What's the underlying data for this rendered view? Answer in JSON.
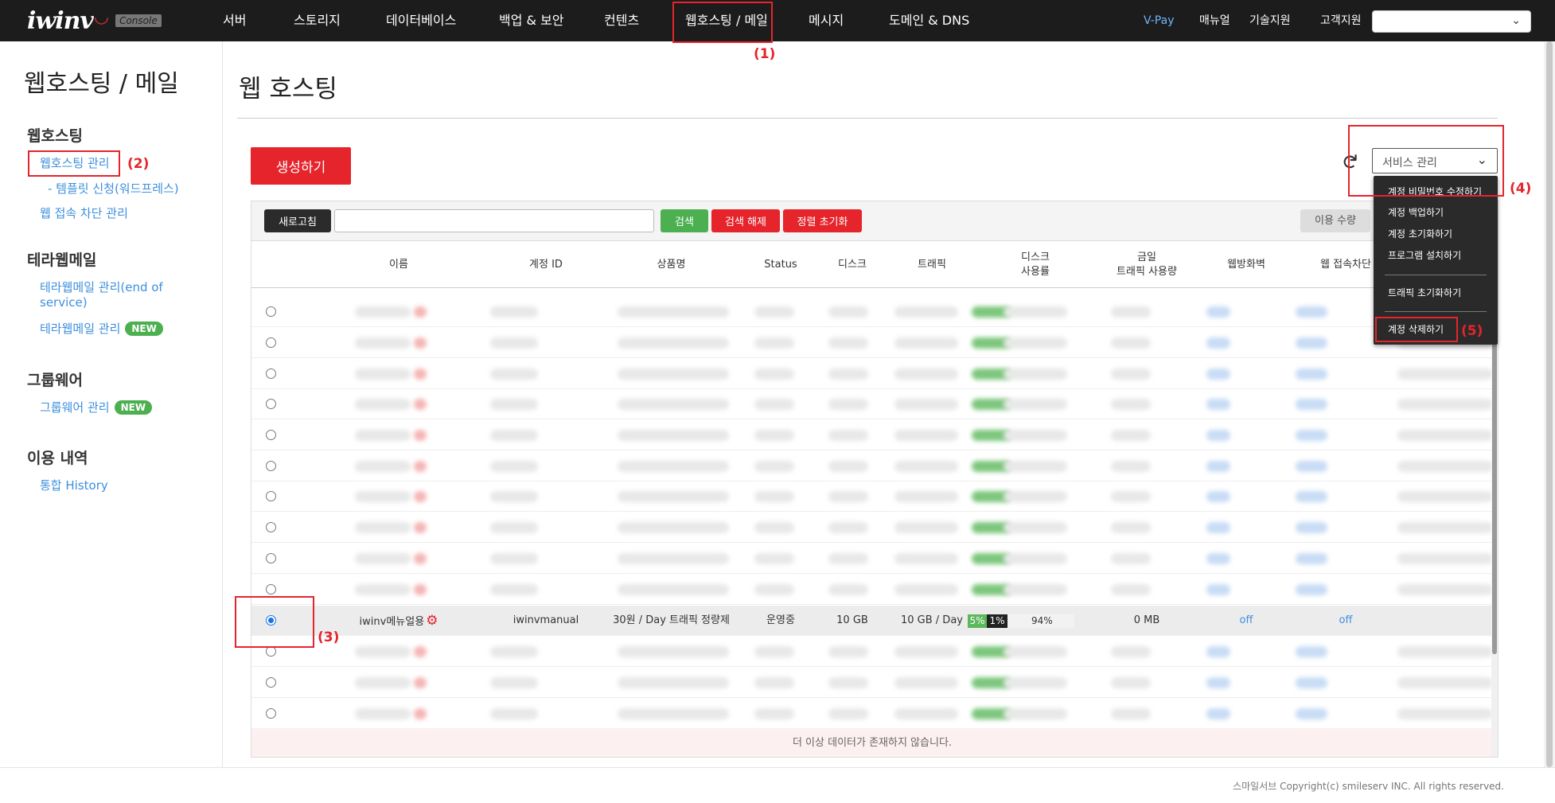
{
  "brand": {
    "logo": "iwinv",
    "console": "Console"
  },
  "nav": {
    "items": [
      "서버",
      "스토리지",
      "데이터베이스",
      "백업 & 보안",
      "컨텐츠",
      "웹호스팅 / 메일",
      "메시지",
      "도메인 & DNS"
    ],
    "right": [
      "V-Pay",
      "매뉴얼",
      "기술지원",
      "고객지원"
    ],
    "account_select": ""
  },
  "sidebar": {
    "title": "웹호스팅 / 메일",
    "sections": [
      {
        "heading": "웹호스팅",
        "links": [
          "웹호스팅 관리",
          "- 템플릿 신청(워드프레스)",
          "웹 접속 차단 관리"
        ]
      },
      {
        "heading": "테라웹메일",
        "links": [
          "테라웹메일 관리(end of",
          "service)",
          "테라웹메일 관리"
        ]
      },
      {
        "heading": "그룹웨어",
        "links": [
          "그룹웨어 관리"
        ]
      },
      {
        "heading": "이용 내역",
        "links": [
          "통합 History"
        ]
      }
    ],
    "new_badge": "NEW"
  },
  "main": {
    "title": "웹 호스팅",
    "create_button": "생성하기",
    "service_select": "서비스 관리"
  },
  "toolbar": {
    "refresh": "새로고침",
    "search_value": "",
    "search": "검색",
    "clear_search": "검색 해제",
    "reset_sort": "정렬 초기화",
    "usage": "이용 수량"
  },
  "table": {
    "headers": [
      "이름",
      "계정 ID",
      "상품명",
      "Status",
      "디스크",
      "트래픽",
      "디스크\n사용률",
      "금일\n트래픽 사용량",
      "웹방화벽",
      "웹 접속차단"
    ],
    "selected_row": {
      "name": "iwinv메뉴얼용",
      "account_id": "iwinvmanual",
      "product": "30원 / Day 트래픽 정량제",
      "status": "운영중",
      "disk": "10 GB",
      "traffic": "10 GB / Day",
      "disk_usage_pct": "5%",
      "disk_usage_2": "1%",
      "traffic_pct": "94%",
      "today_traffic": "0 MB",
      "waf": "off",
      "web_block": "off"
    },
    "footer_message": "더 이상 데이터가 존재하지 않습니다."
  },
  "menu": {
    "items": [
      "계정 비밀번호 수정하기",
      "계정 백업하기",
      "계정 초기화하기",
      "프로그램 설치하기",
      "트래픽 초기화하기",
      "계정 삭제하기"
    ],
    "partial_text": "계정 삭제하기"
  },
  "annotations": [
    "(1)",
    "(2)",
    "(3)",
    "(4)",
    "(5)"
  ],
  "footer": {
    "copyright": "스마일서브 Copyright(c) smileserv INC. All rights reserved."
  },
  "colors": {
    "accent_red": "#e5242c",
    "link_blue": "#3d8fde",
    "nav_bg": "#1c1c1c",
    "green": "#4caf50"
  }
}
